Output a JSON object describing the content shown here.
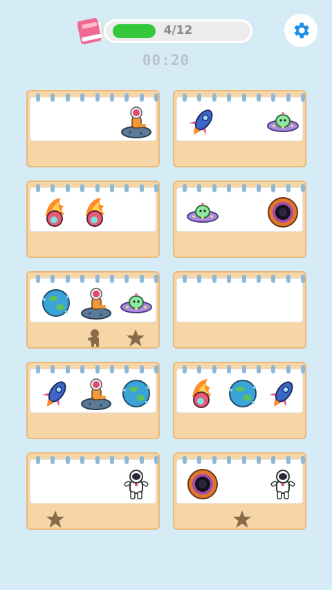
{
  "header": {
    "progress_text": "4/12",
    "progress_fraction": 0.33,
    "timer": "00:20",
    "icons": {
      "left": "book-icon",
      "right": "gear-icon"
    }
  },
  "cards": [
    {
      "items": [
        "",
        "",
        "astronaut-on-rock"
      ],
      "shadows": []
    },
    {
      "items": [
        "rocket",
        "",
        "ufo"
      ],
      "shadows": []
    },
    {
      "items": [
        "meteor",
        "meteor",
        ""
      ],
      "shadows": []
    },
    {
      "items": [
        "ufo",
        "",
        "black-hole"
      ],
      "shadows": []
    },
    {
      "items": [
        "planet",
        "astronaut-on-rock",
        "ufo"
      ],
      "shadows": [
        "",
        "astronaut-silhouette",
        "star-silhouette"
      ]
    },
    {
      "items": [
        "",
        "",
        ""
      ],
      "shadows": []
    },
    {
      "items": [
        "rocket",
        "astronaut-on-rock",
        "planet"
      ],
      "shadows": []
    },
    {
      "items": [
        "meteor",
        "planet",
        "rocket"
      ],
      "shadows": []
    },
    {
      "items": [
        "",
        "",
        "astronaut"
      ],
      "shadows": [
        "star-silhouette",
        "",
        ""
      ]
    },
    {
      "items": [
        "black-hole",
        "",
        "astronaut"
      ],
      "shadows": [
        "",
        "star-silhouette",
        ""
      ]
    }
  ],
  "colors": {
    "background": "#d5ecf7",
    "progress_fill": "#34c93a",
    "card": "#f6d6a6",
    "gear": "#1e8ee6"
  }
}
